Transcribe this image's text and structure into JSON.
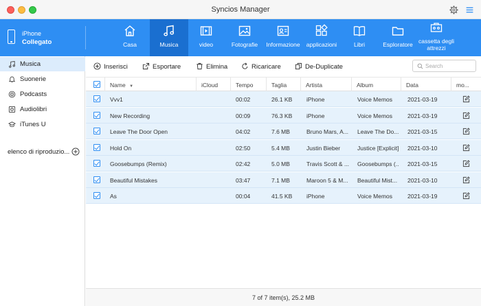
{
  "window": {
    "title": "Syncios Manager"
  },
  "device": {
    "name": "iPhone",
    "status": "Collegato"
  },
  "nav": [
    {
      "label": "Casa",
      "icon": "home-icon"
    },
    {
      "label": "Musica",
      "icon": "music-icon"
    },
    {
      "label": "video",
      "icon": "video-icon"
    },
    {
      "label": "Fotografie",
      "icon": "photo-icon"
    },
    {
      "label": "Informazione",
      "icon": "contact-card-icon"
    },
    {
      "label": "applicazioni",
      "icon": "apps-icon"
    },
    {
      "label": "Libri",
      "icon": "book-icon"
    },
    {
      "label": "Esploratore",
      "icon": "folder-icon"
    },
    {
      "label": "cassetta degli attrezzi",
      "icon": "toolbox-icon"
    }
  ],
  "sidebar": {
    "items": [
      {
        "label": "Musica",
        "icon": "music-note-icon"
      },
      {
        "label": "Suonerie",
        "icon": "bell-icon"
      },
      {
        "label": "Podcasts",
        "icon": "podcast-icon"
      },
      {
        "label": "Audiolibri",
        "icon": "audiobook-icon"
      },
      {
        "label": "iTunes U",
        "icon": "graduation-cap-icon"
      }
    ],
    "playlist_label": "elenco di riproduzio..."
  },
  "toolbar": {
    "import": "Inserisci",
    "export": "Esportare",
    "delete": "Elimina",
    "reload": "Ricaricare",
    "dedupe": "De-Duplicate",
    "search_placeholder": "Search"
  },
  "table": {
    "columns": [
      "Name",
      "iCloud",
      "Tempo",
      "Taglia",
      "Artista",
      "Album",
      "Data",
      "mo..."
    ],
    "rows": [
      {
        "name": "Vvv1",
        "icloud": "",
        "time": "00:02",
        "size": "26.1 KB",
        "artist": "iPhone",
        "album": "Voice Memos",
        "date": "2021-03-19"
      },
      {
        "name": "New Recording",
        "icloud": "",
        "time": "00:09",
        "size": "76.3 KB",
        "artist": "iPhone",
        "album": "Voice Memos",
        "date": "2021-03-19"
      },
      {
        "name": "Leave The Door Open",
        "icloud": "",
        "time": "04:02",
        "size": "7.6 MB",
        "artist": "Bruno Mars, A...",
        "album": "Leave The Do...",
        "date": "2021-03-15"
      },
      {
        "name": "Hold On",
        "icloud": "",
        "time": "02:50",
        "size": "5.4 MB",
        "artist": "Justin Bieber",
        "album": "Justice [Explicit]",
        "date": "2021-03-10"
      },
      {
        "name": "Goosebumps (Remix)",
        "icloud": "",
        "time": "02:42",
        "size": "5.0 MB",
        "artist": "Travis Scott & ...",
        "album": "Goosebumps (...",
        "date": "2021-03-15"
      },
      {
        "name": "Beautiful Mistakes",
        "icloud": "",
        "time": "03:47",
        "size": "7.1 MB",
        "artist": "Maroon 5 & M...",
        "album": "Beautiful Mist...",
        "date": "2021-03-10"
      },
      {
        "name": "As",
        "icloud": "",
        "time": "00:04",
        "size": "41.5 KB",
        "artist": "iPhone",
        "album": "Voice Memos",
        "date": "2021-03-19"
      }
    ]
  },
  "status": {
    "text": "7 of 7 item(s), 25.2 MB"
  },
  "colors": {
    "accent": "#2e8ef3",
    "accent_dark": "#1a6fd0",
    "row_selected": "#e6f2fc"
  }
}
